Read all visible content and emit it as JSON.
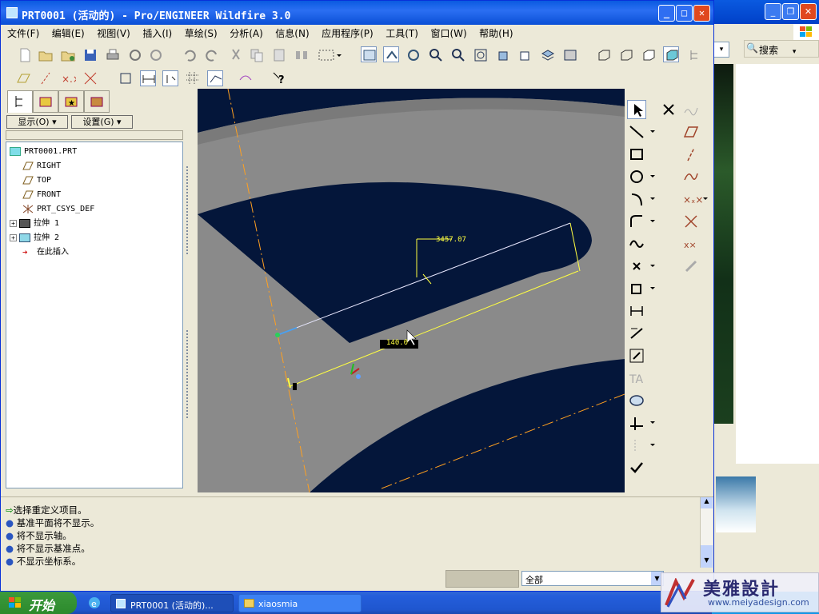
{
  "window": {
    "title": "PRT0001 (活动的) - Pro/ENGINEER Wildfire 3.0"
  },
  "menu": [
    "文件(F)",
    "编辑(E)",
    "视图(V)",
    "插入(I)",
    "草绘(S)",
    "分析(A)",
    "信息(N)",
    "应用程序(P)",
    "工具(T)",
    "窗口(W)",
    "帮助(H)"
  ],
  "model_tree": {
    "show_button": "显示(O) ▾",
    "settings_button": "设置(G) ▾",
    "nodes": [
      "PRT0001.PRT",
      "RIGHT",
      "TOP",
      "FRONT",
      "PRT_CSYS_DEF",
      "拉伸 1",
      "拉伸 2",
      "在此插入"
    ]
  },
  "sketch": {
    "dim1": "3457.07",
    "dim2": "140.0"
  },
  "messages": [
    "选择重定义项目。",
    "基准平面将不显示。",
    "将不显示轴。",
    "将不显示基准点。",
    "不显示坐标系。"
  ],
  "status": {
    "filter": "全部"
  },
  "background_window": {
    "search_label": "搜索"
  },
  "taskbar": {
    "start": "开始",
    "task1": "PRT0001 (活动的)...",
    "task2": "xiaosmia"
  },
  "watermark": {
    "text": "美雅設計",
    "url": "www.meiyadesign.com"
  },
  "colors": {
    "viewport_dark": "#04163a",
    "surface_gray": "#8a8a8a",
    "dimension_yellow": "#ffff40",
    "datum_orange": "#ffa020"
  }
}
